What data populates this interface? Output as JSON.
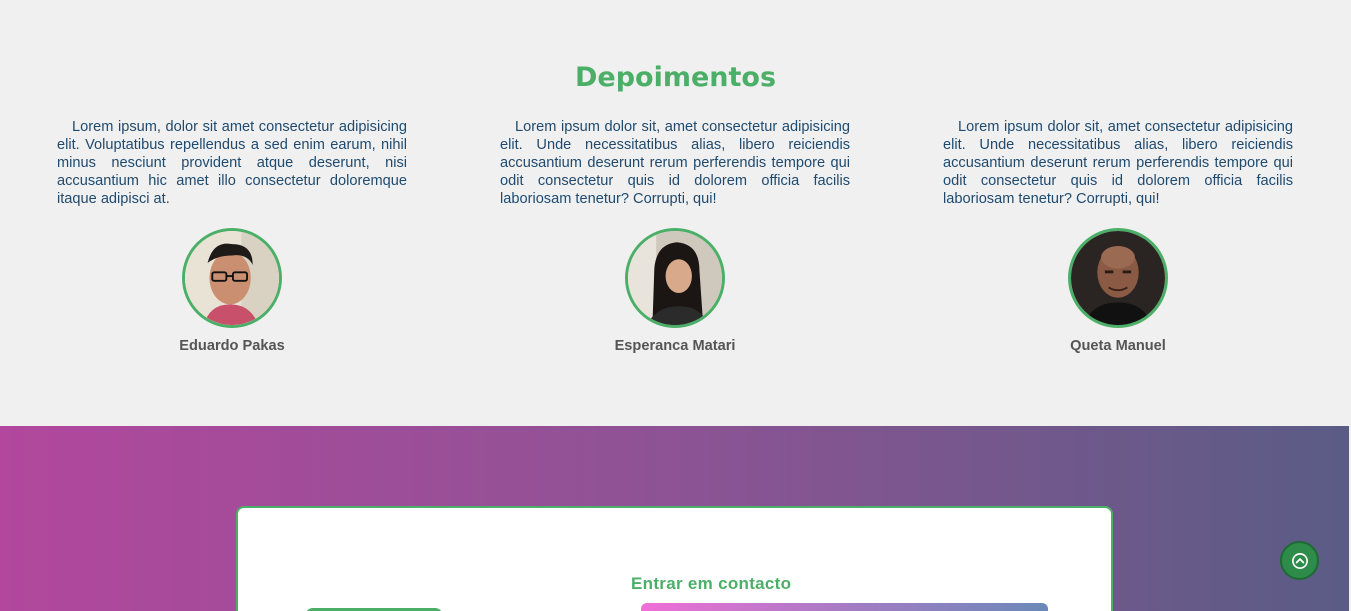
{
  "testimonials": {
    "title": "Depoimentos",
    "items": [
      {
        "text": "Lorem ipsum, dolor sit amet consectetur adipisicing elit. Voluptatibus repellendus a sed enim earum, nihil minus nesciunt provident atque deserunt, nisi accusantium hic amet illo consectetur doloremque itaque adipisci at.",
        "name": "Eduardo Pakas",
        "avatar": "avatar-young-man-glasses"
      },
      {
        "text": "Lorem ipsum dolor sit, amet consectetur adipisicing elit. Unde necessitatibus alias, libero reiciendis accusantium deserunt rerum perferendis tempore qui odit consectetur quis id dolorem officia facilis laboriosam tenetur? Corrupti, qui!",
        "name": "Esperanca Matari",
        "avatar": "avatar-woman-dark-hair"
      },
      {
        "text": "Lorem ipsum dolor sit, amet consectetur adipisicing elit. Unde necessitatibus alias, libero reiciendis accusantium deserunt rerum perferendis tempore qui odit consectetur quis id dolorem officia facilis laboriosam tenetur? Corrupti, qui!",
        "name": "Queta Manuel",
        "avatar": "avatar-bald-man"
      }
    ]
  },
  "contact": {
    "title": "Entrar em contacto"
  },
  "scroll_top": {
    "icon": "chevron-up-circle-icon"
  },
  "colors": {
    "accent": "#4caf68",
    "text": "#1f4a6e",
    "gradient_start": "#b2479d",
    "gradient_end": "#5a5c85"
  }
}
